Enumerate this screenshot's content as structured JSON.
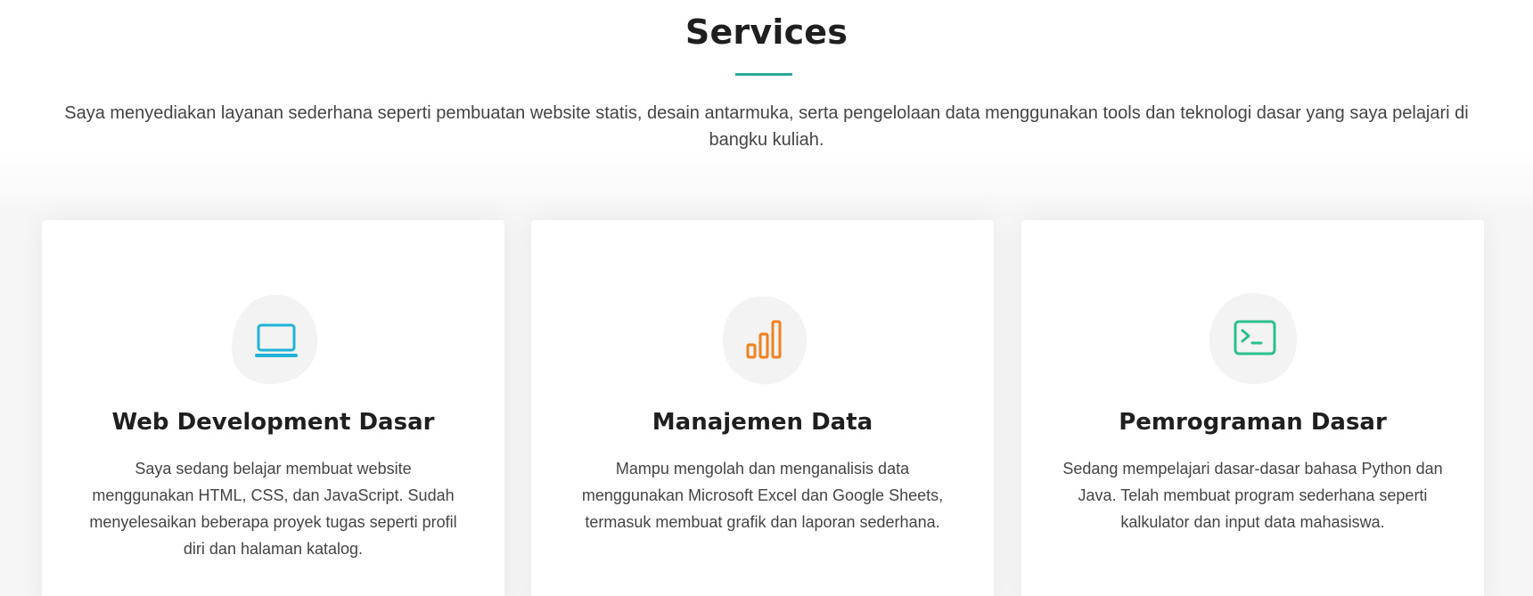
{
  "section": {
    "title": "Services",
    "intro": "Saya menyediakan layanan sederhana seperti pembuatan website statis, desain antarmuka, serta pengelolaan data menggunakan tools dan teknologi dasar yang saya pelajari di bangku kuliah.",
    "accent_color": "#2aa89a"
  },
  "services": [
    {
      "icon": "laptop-icon",
      "icon_color": "#1fb3d8",
      "title": "Web Development Dasar",
      "description": "Saya sedang belajar membuat website menggunakan HTML, CSS, dan JavaScript. Sudah menyelesaikan beberapa proyek tugas seperti profil diri dan halaman katalog."
    },
    {
      "icon": "bar-chart-icon",
      "icon_color": "#f0811e",
      "title": "Manajemen Data",
      "description": "Mampu mengolah dan menganalisis data menggunakan Microsoft Excel dan Google Sheets, termasuk membuat grafik dan laporan sederhana."
    },
    {
      "icon": "terminal-icon",
      "icon_color": "#2bbf8e",
      "title": "Pemrograman Dasar",
      "description": "Sedang mempelajari dasar-dasar bahasa Python dan Java. Telah membuat program sederhana seperti kalkulator dan input data mahasiswa."
    }
  ]
}
